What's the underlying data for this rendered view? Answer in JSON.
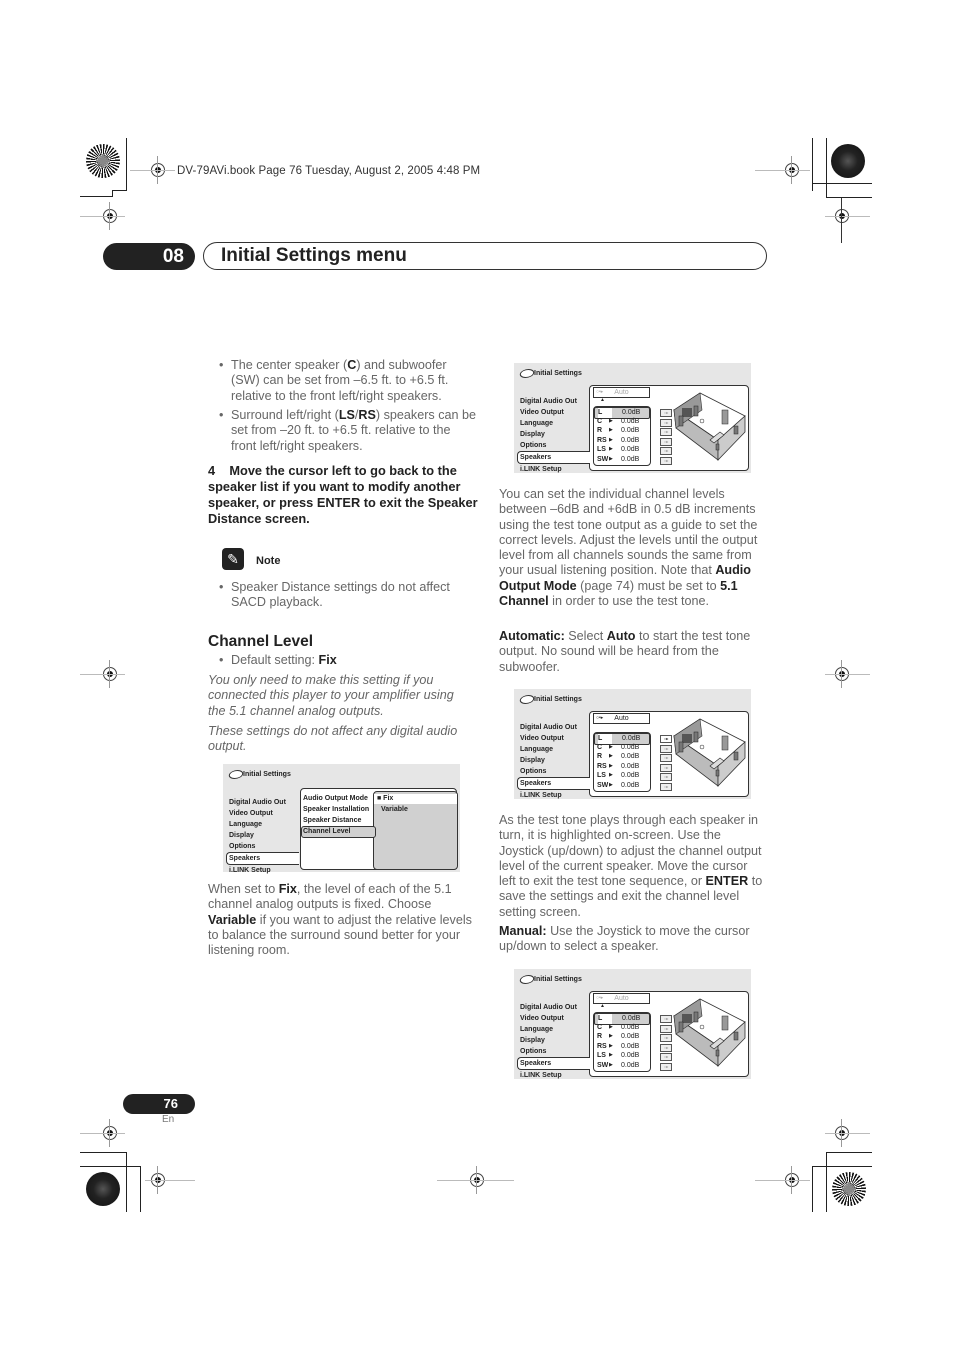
{
  "file_header": "DV-79AVi.book  Page 76  Tuesday, August 2, 2005  4:48 PM",
  "chapter": {
    "number": "08",
    "title": "Initial Settings menu"
  },
  "left_column": {
    "bullets": [
      {
        "pre": "The center speaker (",
        "b1": "C",
        "mid": ") and subwoofer (SW) can be set from –6.5 ft. to +6.5 ft. relative to the front left/right speakers."
      },
      {
        "pre": "Surround left/right (",
        "b1": "LS",
        "sep": "/",
        "b2": "RS",
        "post": ") speakers can be set from –20 ft. to +6.5 ft. relative to the front left/right speakers."
      }
    ],
    "step4": "4    Move the cursor left to go back to the speaker list if you want to modify another speaker, or press ENTER to exit the Speaker Distance screen.",
    "note": {
      "label": "Note",
      "icon": "pencil-icon",
      "text": "Speaker Distance settings do not affect SACD playback."
    },
    "channel_level": {
      "heading": "Channel Level",
      "default_prefix": "Default setting: ",
      "default_value": "Fix",
      "italic1": "You only need to make this setting if you connected this player to your amplifier using the 5.1 channel analog outputs.",
      "italic2": "These settings do not affect any digital audio output."
    },
    "after_screen": {
      "p1": "When set to ",
      "b1": "Fix",
      "p2": ", the level of each of the 5.1 channel analog outputs is fixed. Choose ",
      "b2": "Variable",
      "p3": " if you want to adjust the relative levels to balance the surround sound better for your listening room."
    }
  },
  "right_column": {
    "para1": {
      "p1": "You can set the individual channel levels between –6dB and +6dB in 0.5 dB increments using the test tone output as a guide to set the correct levels. Adjust the levels until the output level from all channels sounds the same from your usual listening position. Note that ",
      "b1": "Audio Output Mode",
      "p2": " (page 74) must be set to ",
      "b2": "5.1 Channel",
      "p3": " in order to use the test tone."
    },
    "automatic": {
      "label": "Automatic:",
      "p1": " Select ",
      "b1": "Auto",
      "p2": " to start the test tone output. No sound will be heard from the subwoofer."
    },
    "para2": {
      "p1": "As the test tone plays through each speaker in turn, it is highlighted on-screen. Use the Joystick (up/down) to adjust the channel output level of the current speaker. Move the cursor left to exit the test tone sequence, or ",
      "b1": "ENTER",
      "p2": " to save the settings and exit the channel level setting screen."
    },
    "manual": {
      "label": "Manual:",
      "p1": " Use the Joystick to move the cursor up/down to select a speaker."
    }
  },
  "osd": {
    "title": "Initial Settings",
    "menu": [
      "Digital Audio Out",
      "Video Output",
      "Language",
      "Display",
      "Options",
      "Speakers",
      "i.LINK Setup"
    ],
    "selected_menu": "Speakers",
    "submenu": [
      "Audio Output Mode",
      "Speaker Installation",
      "Speaker Distance",
      "Channel Level"
    ],
    "selected_submenu": "Channel Level",
    "options": [
      "■ Fix",
      "Variable"
    ],
    "auto_label": "Auto",
    "channels": [
      {
        "name": "L",
        "value": "0.0dB"
      },
      {
        "name": "C",
        "value": "0.0dB"
      },
      {
        "name": "R",
        "value": "0.0dB"
      },
      {
        "name": "RS",
        "value": "0.0dB"
      },
      {
        "name": "LS",
        "value": "0.0dB"
      },
      {
        "name": "SW",
        "value": "0.0dB"
      }
    ]
  },
  "footer": {
    "page_number": "76",
    "language": "En"
  }
}
